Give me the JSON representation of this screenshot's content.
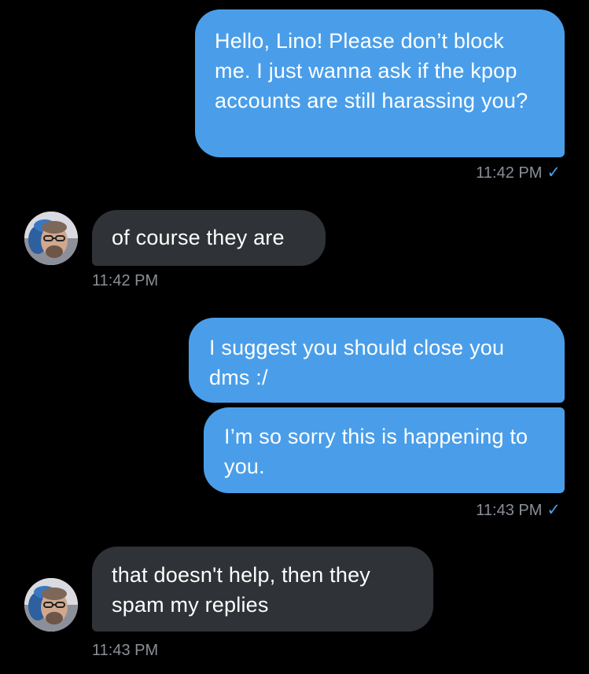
{
  "messages": [
    {
      "sender": "me",
      "text": "Hello, Lino! Please don’t block me. I just wanna ask if the kpop accounts are still harassing you?"
    },
    {
      "sender": "me_meta",
      "time": "11:42 PM",
      "status": "✓"
    },
    {
      "sender": "them",
      "text": "of course they are",
      "time": "11:42 PM"
    },
    {
      "sender": "me",
      "text": "I suggest you should close you dms :/"
    },
    {
      "sender": "me",
      "text": "I’m so sorry this is happening to you.",
      "time": "11:43 PM",
      "status": "✓"
    },
    {
      "sender": "them",
      "text": "that doesn't help, then they spam my replies",
      "time": "11:43 PM"
    }
  ],
  "colors": {
    "outgoing_bubble": "#4a9ee9",
    "incoming_bubble": "#2f3237",
    "background": "#000000",
    "timestamp": "#8a8f97",
    "read_check": "#4a9ee9"
  },
  "icons": {
    "avatar": "user-avatar",
    "read_receipt": "checkmark-icon"
  }
}
